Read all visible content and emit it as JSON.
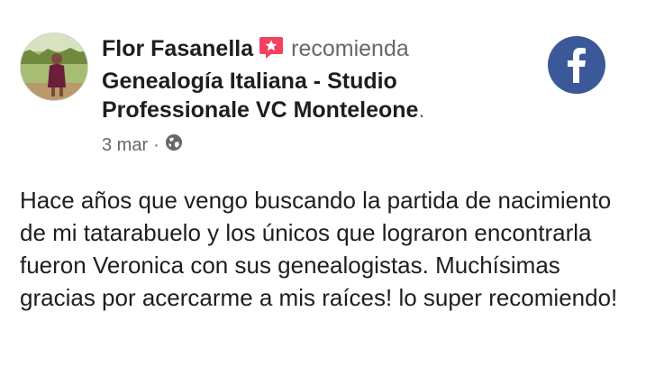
{
  "post": {
    "author": "Flor Fasanella",
    "verb": "recomienda",
    "page_name": "Genealogía Italiana - Studio Professionale VC Monteleone",
    "page_period": ".",
    "date": "3 mar",
    "separator": "·",
    "audience_icon": "globe-icon",
    "recommend_icon": "recommend-star-icon",
    "recommend_color": "#f3425f",
    "brand_icon": "facebook-logo-icon",
    "brand_color": "#3b5998",
    "text": "Hace años que vengo buscando la partida de nacimiento de mi tatarabuelo y los únicos que lograron encontrarla fueron Veronica con sus genealogistas. Muchísimas gracias por acercarme a mis raíces! lo super recomiendo!"
  }
}
